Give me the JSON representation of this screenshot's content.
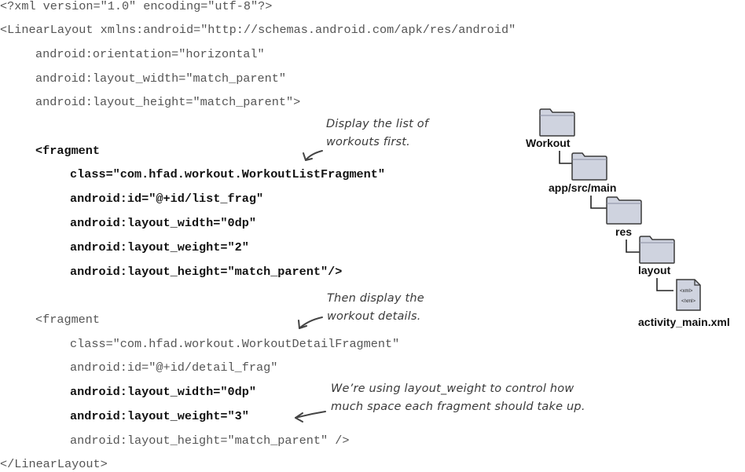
{
  "code": {
    "lines": [
      "<?xml version=\"1.0\" encoding=\"utf-8\"?>",
      "<LinearLayout xmlns:android=\"http://schemas.android.com/apk/res/android\"",
      "android:orientation=\"horizontal\"",
      "android:layout_width=\"match_parent\"",
      "android:layout_height=\"match_parent\">",
      "<fragment",
      "class=\"com.hfad.workout.WorkoutListFragment\"",
      "android:id=\"@+id/list_frag\"",
      "android:layout_width=\"0dp\"",
      "android:layout_weight=\"2\"",
      "android:layout_height=\"match_parent\"/>",
      "<fragment",
      "class=\"com.hfad.workout.WorkoutDetailFragment\"",
      "android:id=\"@+id/detail_frag\"",
      "android:layout_width=\"0dp\"",
      "android:layout_weight=\"3\"",
      "android:layout_height=\"match_parent\" />",
      "</LinearLayout>"
    ]
  },
  "annotations": {
    "note1_line1": "Display the list of",
    "note1_line2": "workouts first.",
    "note2_line1": "Then display the",
    "note2_line2": "workout details.",
    "note3_line1": "We’re using layout_weight to control how",
    "note3_line2": "much space each fragment should take up."
  },
  "folder_tree": {
    "root": "Workout",
    "src": "app/src/main",
    "res": "res",
    "layout": "layout",
    "file": "activity_main.xml",
    "file_icon_text_1": "<xml>",
    "file_icon_text_2": "</xml>"
  },
  "colors": {
    "code_regular": "#555555",
    "code_bold": "#111111",
    "folder_fill": "#cfd3df",
    "folder_stroke": "#3a3a3a"
  }
}
